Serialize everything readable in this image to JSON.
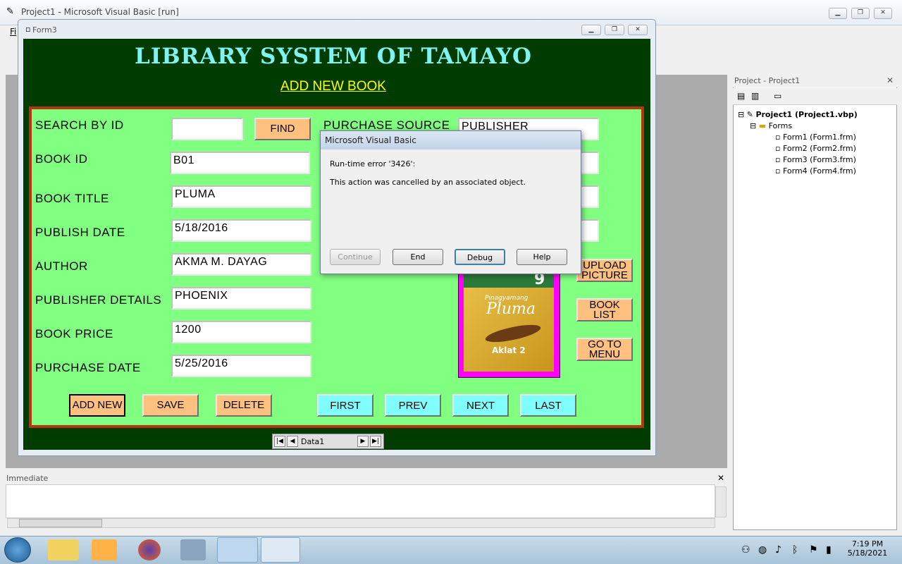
{
  "ide": {
    "title": "Project1 - Microsoft Visual Basic [run]",
    "menu_first": "Fi"
  },
  "form3": {
    "title": "Form3",
    "app_title": "LIBRARY SYSTEM OF TAMAYO",
    "sub_title": "ADD NEW BOOK",
    "labels": {
      "search": "SEARCH BY ID",
      "book_id": "BOOK ID",
      "book_title": "BOOK TITLE",
      "publish_date": "PUBLISH DATE",
      "author": "AUTHOR",
      "publisher": "PUBLISHER DETAILS",
      "price": "BOOK PRICE",
      "purchase_date": "PURCHASE DATE",
      "purchase_source": "PURCHASE SOURCE"
    },
    "values": {
      "search": "",
      "book_id": "B01",
      "book_title": "PLUMA",
      "publish_date": "5/18/2016",
      "author": "AKMA M. DAYAG",
      "publisher": "PHOENIX",
      "price": "1200",
      "purchase_date": "5/25/2016",
      "purchase_source": "PUBLISHER"
    },
    "buttons": {
      "find": "FIND",
      "add_new": "ADD NEW",
      "save": "SAVE",
      "delete": "DELETE",
      "first": "FIRST",
      "prev": "PREV",
      "next": "NEXT",
      "last": "LAST",
      "upload_1": "UPLOAD",
      "upload_2": "PICTURE",
      "book_1": "BOOK",
      "book_2": "LIST",
      "menu_1": "GO TO",
      "menu_2": "MENU"
    },
    "data_control": "Data1",
    "cover": {
      "number": "9",
      "line1": "Pinagyamang",
      "line2": "Pluma",
      "line3": "Aklat 2"
    }
  },
  "dialog": {
    "title": "Microsoft Visual Basic",
    "error": "Run-time error '3426':",
    "message": "This action was cancelled by an associated object.",
    "buttons": {
      "continue": "Continue",
      "end": "End",
      "debug": "Debug",
      "help": "Help"
    }
  },
  "project": {
    "title": "Project - Project1",
    "root": "Project1 (Project1.vbp)",
    "folder": "Forms",
    "forms": [
      "Form1 (Form1.frm)",
      "Form2 (Form2.frm)",
      "Form3 (Form3.frm)",
      "Form4 (Form4.frm)"
    ]
  },
  "immediate": {
    "title": "Immediate"
  },
  "clock": {
    "time": "7:19 PM",
    "date": "5/18/2021"
  }
}
